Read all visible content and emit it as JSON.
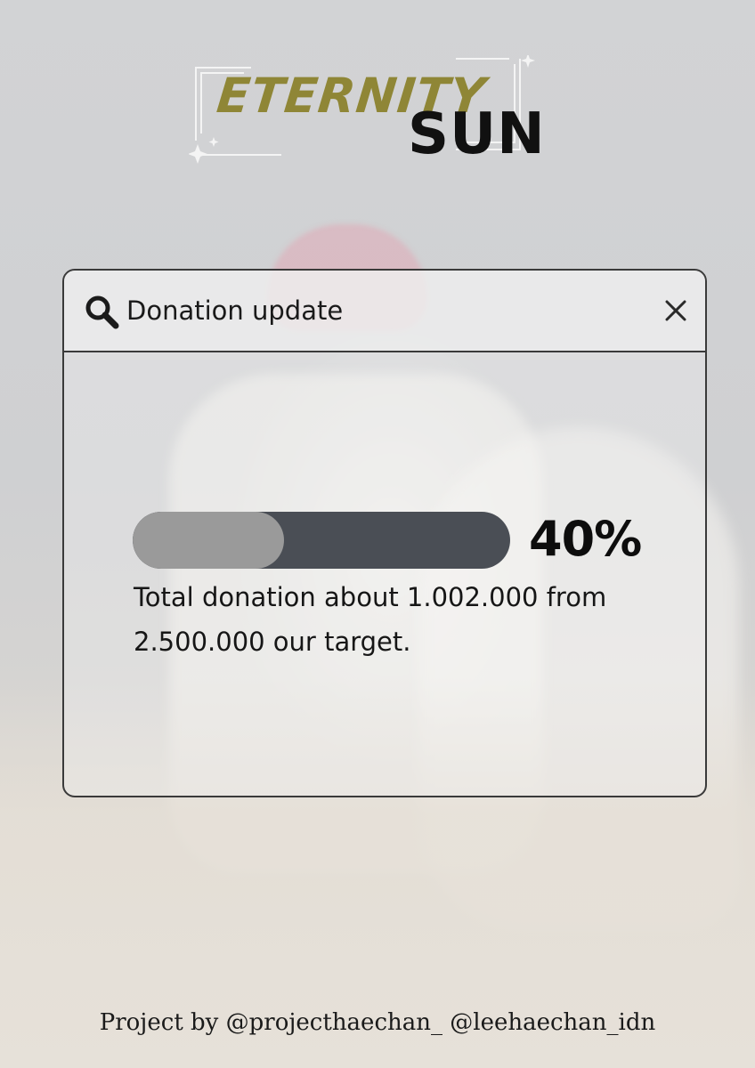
{
  "logo": {
    "word1": "ETERNITY",
    "word2": "SUN"
  },
  "window": {
    "title": "Donation update",
    "search_icon": "search-icon",
    "close_icon": "close-icon"
  },
  "progress": {
    "percent_label": "40%",
    "fraction": 0.4
  },
  "donation": {
    "text": "Total donation about 1.002.000 from 2.500.000 our target."
  },
  "footer": {
    "text": "Project by @projecthaechan_  @leehaechan_idn"
  },
  "colors": {
    "logo_gold": "#8f8636",
    "progress_track": "#4a4e55",
    "progress_fill": "#9a9a9a"
  }
}
